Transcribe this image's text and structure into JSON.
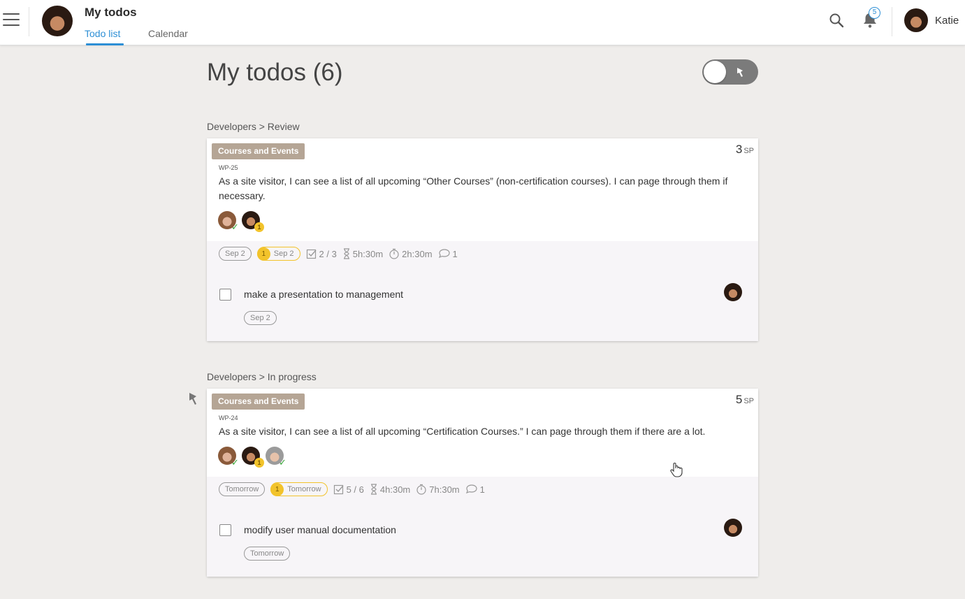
{
  "header": {
    "app_title": "My todos",
    "tabs": [
      {
        "label": "Todo list",
        "active": true
      },
      {
        "label": "Calendar",
        "active": false
      }
    ],
    "notification_count": "5",
    "user_name": "Katie",
    "accent_color": "#2d8fd5"
  },
  "page": {
    "title": "My todos (6)"
  },
  "groups": [
    {
      "title": "Developers > Review",
      "card": {
        "tag": "Courses and Events",
        "sp_value": "3",
        "sp_unit": "SP",
        "id": "WP-25",
        "story": "As a site visitor, I can see a list of all upcoming “Other Courses” (non-certification courses). I can page through them if necessary.",
        "assignees": [
          {
            "face": "male",
            "mark": "✓"
          },
          {
            "face": "female",
            "mark": "1"
          }
        ],
        "meta": {
          "due": "Sep 2",
          "my_due_count": "1",
          "my_due": "Sep 2",
          "checklist": "2 / 3",
          "estimate": "5h:30m",
          "logged": "2h:30m",
          "comments": "1"
        },
        "todo": {
          "text": "make a presentation to management",
          "due": "Sep 2"
        }
      }
    },
    {
      "title": "Developers > In progress",
      "card": {
        "tag": "Courses and Events",
        "sp_value": "5",
        "sp_unit": "SP",
        "id": "WP-24",
        "story": "As a site visitor, I can see a list of all upcoming “Certification Courses.” I can page through them if there are a lot.",
        "assignees": [
          {
            "face": "male",
            "mark": "✓"
          },
          {
            "face": "female",
            "mark": "1"
          },
          {
            "face": "gray",
            "mark": "✓"
          }
        ],
        "meta": {
          "due": "Tomorrow",
          "my_due_count": "1",
          "my_due": "Tomorrow",
          "checklist": "5 / 6",
          "estimate": "4h:30m",
          "logged": "7h:30m",
          "comments": "1"
        },
        "todo": {
          "text": "modify user manual documentation",
          "due": "Tomorrow"
        }
      }
    }
  ]
}
